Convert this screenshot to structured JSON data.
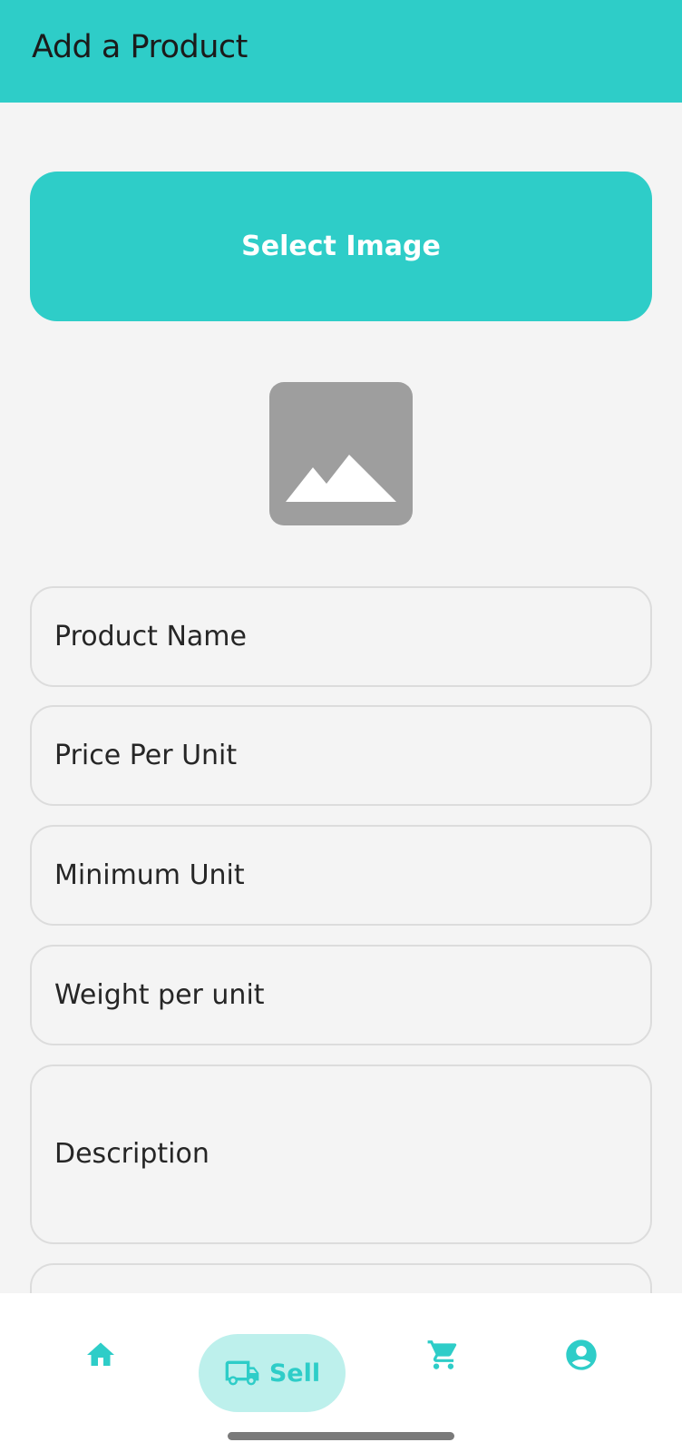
{
  "app_bar": {
    "title": "Add a Product"
  },
  "select_image": {
    "label": "Select Image"
  },
  "form": {
    "product_name": {
      "placeholder": "Product Name"
    },
    "price_per_unit": {
      "placeholder": "Price Per Unit"
    },
    "minimum_unit": {
      "placeholder": "Minimum Unit"
    },
    "weight_per_unit": {
      "placeholder": "Weight per unit"
    },
    "description": {
      "placeholder": "Description"
    }
  },
  "bottom_nav": {
    "items": [
      {
        "icon": "home-icon",
        "label": ""
      },
      {
        "icon": "truck-icon",
        "label": "Sell",
        "selected": true
      },
      {
        "icon": "cart-icon",
        "label": ""
      },
      {
        "icon": "account-icon",
        "label": ""
      }
    ]
  },
  "colors": {
    "primary": "#2ecdc8",
    "selected_pill": "#bdf0ec",
    "background": "#f4f4f4",
    "placeholder_icon": "#9e9e9e"
  }
}
